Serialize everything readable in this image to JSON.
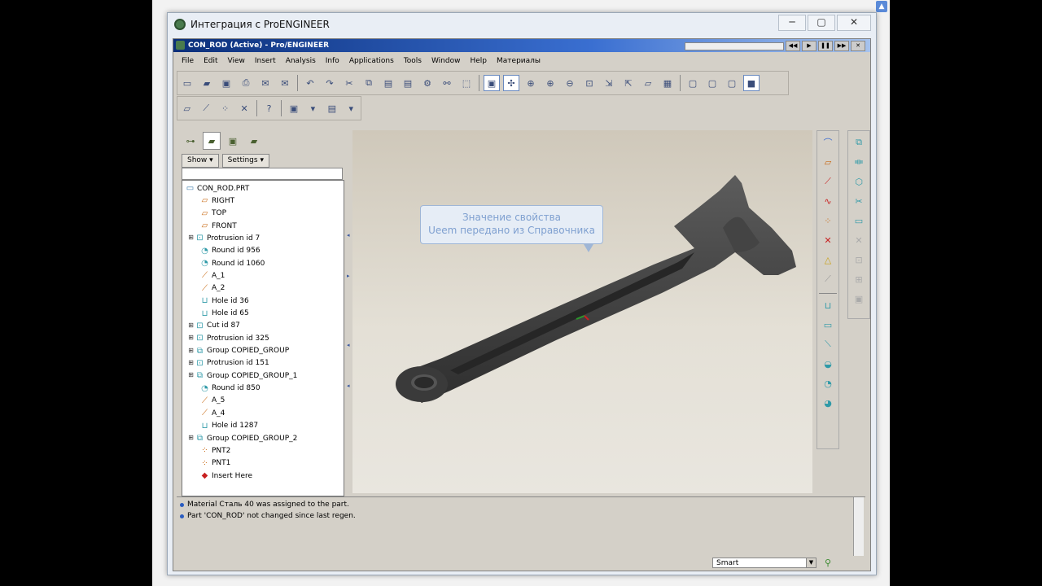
{
  "outer_window": {
    "title": "Интеграция с ProENGINEER",
    "minimize": "─",
    "restore": "▢",
    "close": "✕"
  },
  "inner_window": {
    "title": "CON_ROD (Active) - Pro/ENGINEER"
  },
  "menu": [
    "File",
    "Edit",
    "View",
    "Insert",
    "Analysis",
    "Info",
    "Applications",
    "Tools",
    "Window",
    "Help",
    "Материалы"
  ],
  "toolbar1": [
    {
      "icon": "new-icon",
      "glyph": "▭"
    },
    {
      "icon": "open-icon",
      "glyph": "▰"
    },
    {
      "icon": "save-icon",
      "glyph": "▣"
    },
    {
      "icon": "print-icon",
      "glyph": "⎙"
    },
    {
      "icon": "email-icon",
      "glyph": "✉"
    },
    {
      "icon": "email-link-icon",
      "glyph": "✉"
    },
    {
      "sep": true
    },
    {
      "icon": "undo-icon",
      "glyph": "↶"
    },
    {
      "icon": "redo-icon",
      "glyph": "↷"
    },
    {
      "icon": "cut-icon",
      "glyph": "✂"
    },
    {
      "icon": "copy-icon",
      "glyph": "⧉"
    },
    {
      "icon": "paste-icon",
      "glyph": "▤"
    },
    {
      "icon": "paste-special-icon",
      "glyph": "▤"
    },
    {
      "icon": "regenerate-icon",
      "glyph": "⚙"
    },
    {
      "icon": "find-icon",
      "glyph": "⚯"
    },
    {
      "icon": "select-box-icon",
      "glyph": "⬚"
    },
    {
      "sep": true
    },
    {
      "icon": "repaint-icon",
      "glyph": "▣",
      "active": true
    },
    {
      "icon": "spin-center-icon",
      "glyph": "✣",
      "active": true
    },
    {
      "icon": "orient-icon",
      "glyph": "⊕"
    },
    {
      "icon": "zoom-in-icon",
      "glyph": "⊕"
    },
    {
      "icon": "zoom-out-icon",
      "glyph": "⊖"
    },
    {
      "icon": "refit-icon",
      "glyph": "⊡"
    },
    {
      "icon": "reorient-icon",
      "glyph": "⇲"
    },
    {
      "icon": "saved-views-icon",
      "glyph": "⇱"
    },
    {
      "icon": "layers-icon",
      "glyph": "▱"
    },
    {
      "icon": "view-manager-icon",
      "glyph": "▦"
    },
    {
      "sep": true
    },
    {
      "icon": "wireframe-icon",
      "glyph": "▢"
    },
    {
      "icon": "hidden-line-icon",
      "glyph": "▢"
    },
    {
      "icon": "no-hidden-icon",
      "glyph": "▢"
    },
    {
      "icon": "shading-icon",
      "glyph": "■",
      "active": true
    }
  ],
  "toolbar2": [
    {
      "icon": "datum-planes-icon",
      "glyph": "▱"
    },
    {
      "icon": "datum-axes-icon",
      "glyph": "⟋"
    },
    {
      "icon": "datum-points-icon",
      "glyph": "⁘"
    },
    {
      "icon": "datum-csys-icon",
      "glyph": "✕"
    },
    {
      "sep": true
    },
    {
      "icon": "context-help-icon",
      "glyph": "?"
    },
    {
      "sep": true
    },
    {
      "icon": "model-tree-toggle-icon",
      "glyph": "▣"
    },
    {
      "icon": "dropdown-icon",
      "glyph": "▾"
    },
    {
      "icon": "annotation-icon",
      "glyph": "▤"
    },
    {
      "icon": "dropdown-icon",
      "glyph": "▾"
    }
  ],
  "nav_tabs": [
    {
      "name": "model-tree-tab-icon",
      "glyph": "⊶",
      "selected": false
    },
    {
      "name": "folder-browser-tab-icon",
      "glyph": "▰",
      "selected": true
    },
    {
      "name": "favorites-tab-icon",
      "glyph": "▣",
      "selected": false
    },
    {
      "name": "connections-tab-icon",
      "glyph": "▰",
      "selected": false
    }
  ],
  "tree_controls": {
    "show": "Show ▾",
    "settings": "Settings ▾"
  },
  "tree": [
    {
      "label": "CON_ROD.PRT",
      "indent": 0,
      "expand": "",
      "icon": "part-icon",
      "glyph": "▭",
      "color": "c-blue"
    },
    {
      "label": "RIGHT",
      "indent": 1,
      "expand": "",
      "icon": "datum-plane-icon",
      "glyph": "▱",
      "color": "c-orange"
    },
    {
      "label": "TOP",
      "indent": 1,
      "expand": "",
      "icon": "datum-plane-icon",
      "glyph": "▱",
      "color": "c-orange"
    },
    {
      "label": "FRONT",
      "indent": 1,
      "expand": "",
      "icon": "datum-plane-icon",
      "glyph": "▱",
      "color": "c-orange"
    },
    {
      "label": "Protrusion id 7",
      "indent": 0,
      "expand": "⊞",
      "icon": "protrusion-icon",
      "glyph": "⊡",
      "color": "c-teal"
    },
    {
      "label": "Round id 956",
      "indent": 1,
      "expand": "",
      "icon": "round-icon",
      "glyph": "◔",
      "color": "c-teal"
    },
    {
      "label": "Round id 1060",
      "indent": 1,
      "expand": "",
      "icon": "round-icon",
      "glyph": "◔",
      "color": "c-teal"
    },
    {
      "label": "A_1",
      "indent": 1,
      "expand": "",
      "icon": "datum-axis-icon",
      "glyph": "⟋",
      "color": "c-orange"
    },
    {
      "label": "A_2",
      "indent": 1,
      "expand": "",
      "icon": "datum-axis-icon",
      "glyph": "⟋",
      "color": "c-orange"
    },
    {
      "label": "Hole id 36",
      "indent": 1,
      "expand": "",
      "icon": "hole-icon",
      "glyph": "⊔",
      "color": "c-teal"
    },
    {
      "label": "Hole id 65",
      "indent": 1,
      "expand": "",
      "icon": "hole-icon",
      "glyph": "⊔",
      "color": "c-teal"
    },
    {
      "label": "Cut id 87",
      "indent": 0,
      "expand": "⊞",
      "icon": "cut-icon",
      "glyph": "⊡",
      "color": "c-teal"
    },
    {
      "label": "Protrusion id 325",
      "indent": 0,
      "expand": "⊞",
      "icon": "protrusion-icon",
      "glyph": "⊡",
      "color": "c-teal"
    },
    {
      "label": "Group COPIED_GROUP",
      "indent": 0,
      "expand": "⊞",
      "icon": "group-icon",
      "glyph": "⧉",
      "color": "c-teal"
    },
    {
      "label": "Protrusion id 151",
      "indent": 0,
      "expand": "⊞",
      "icon": "protrusion-icon",
      "glyph": "⊡",
      "color": "c-teal"
    },
    {
      "label": "Group COPIED_GROUP_1",
      "indent": 0,
      "expand": "⊞",
      "icon": "group-icon",
      "glyph": "⧉",
      "color": "c-teal"
    },
    {
      "label": "Round id 850",
      "indent": 1,
      "expand": "",
      "icon": "round-icon",
      "glyph": "◔",
      "color": "c-teal"
    },
    {
      "label": "A_5",
      "indent": 1,
      "expand": "",
      "icon": "datum-axis-icon",
      "glyph": "⟋",
      "color": "c-orange"
    },
    {
      "label": "A_4",
      "indent": 1,
      "expand": "",
      "icon": "datum-axis-icon",
      "glyph": "⟋",
      "color": "c-orange"
    },
    {
      "label": "Hole id 1287",
      "indent": 1,
      "expand": "",
      "icon": "hole-icon",
      "glyph": "⊔",
      "color": "c-teal"
    },
    {
      "label": "Group COPIED_GROUP_2",
      "indent": 0,
      "expand": "⊞",
      "icon": "group-icon",
      "glyph": "⧉",
      "color": "c-teal"
    },
    {
      "label": "PNT2",
      "indent": 1,
      "expand": "",
      "icon": "datum-point-icon",
      "glyph": "⁘",
      "color": "c-orange"
    },
    {
      "label": "PNT1",
      "indent": 1,
      "expand": "",
      "icon": "datum-point-icon",
      "glyph": "⁘",
      "color": "c-orange"
    },
    {
      "label": "Insert Here",
      "indent": 1,
      "expand": "",
      "icon": "insert-here-icon",
      "glyph": "◆",
      "color": "c-red"
    }
  ],
  "callout": {
    "line1": "Значение свойства",
    "line2": "Ueem передано из Справочника"
  },
  "right_toolbar1": [
    {
      "name": "sketch-tool-icon",
      "glyph": "⌒",
      "color": "#3a6ad0"
    },
    {
      "name": "plane-tool-icon",
      "glyph": "▱",
      "color": "#c96a14"
    },
    {
      "name": "axis-tool-icon",
      "glyph": "⟋",
      "color": "#c82020"
    },
    {
      "name": "curve-tool-icon",
      "glyph": "∿",
      "color": "#c82020"
    },
    {
      "name": "point-tool-icon",
      "glyph": "⁘",
      "color": "#c96a14"
    },
    {
      "name": "csys-tool-icon",
      "glyph": "✕",
      "color": "#c82020"
    },
    {
      "name": "analysis-tool-icon",
      "glyph": "△",
      "color": "#c9a014"
    },
    {
      "name": "offset-tool-icon",
      "glyph": "⟋",
      "color": "#999"
    },
    {
      "sep": true
    },
    {
      "name": "hole-tool-icon",
      "glyph": "⊔",
      "color": "#2f9aa8"
    },
    {
      "name": "shell-tool-icon",
      "glyph": "▭",
      "color": "#2f9aa8"
    },
    {
      "name": "rib-tool-icon",
      "glyph": "⟍",
      "color": "#2f9aa8"
    },
    {
      "name": "draft-tool-icon",
      "glyph": "◒",
      "color": "#2f9aa8"
    },
    {
      "name": "round-tool-icon",
      "glyph": "◔",
      "color": "#2f9aa8"
    },
    {
      "name": "chamfer-tool-icon",
      "glyph": "◕",
      "color": "#2f9aa8"
    }
  ],
  "right_toolbar2": [
    {
      "name": "copy-tool-icon",
      "glyph": "⧉",
      "color": "#2f9aa8"
    },
    {
      "name": "mirror-tool-icon",
      "glyph": "⟚",
      "color": "#2f9aa8"
    },
    {
      "name": "merge-tool-icon",
      "glyph": "⬡",
      "color": "#2f9aa8"
    },
    {
      "name": "trim-tool-icon",
      "glyph": "✂",
      "color": "#2f9aa8"
    },
    {
      "name": "extend-tool-icon",
      "glyph": "▭",
      "color": "#2f9aa8"
    },
    {
      "name": "intersect-tool-icon",
      "glyph": "✕",
      "color": "#aaa"
    },
    {
      "name": "project-tool-icon",
      "glyph": "⊡",
      "color": "#aaa"
    },
    {
      "name": "thicken-tool-icon",
      "glyph": "⊞",
      "color": "#aaa"
    },
    {
      "name": "solidify-tool-icon",
      "glyph": "▣",
      "color": "#aaa"
    }
  ],
  "messages": [
    "Material Сталь 40 was assigned to the part.",
    "Part 'CON_ROD' not changed since last regen."
  ],
  "status": {
    "filter": "Smart"
  }
}
